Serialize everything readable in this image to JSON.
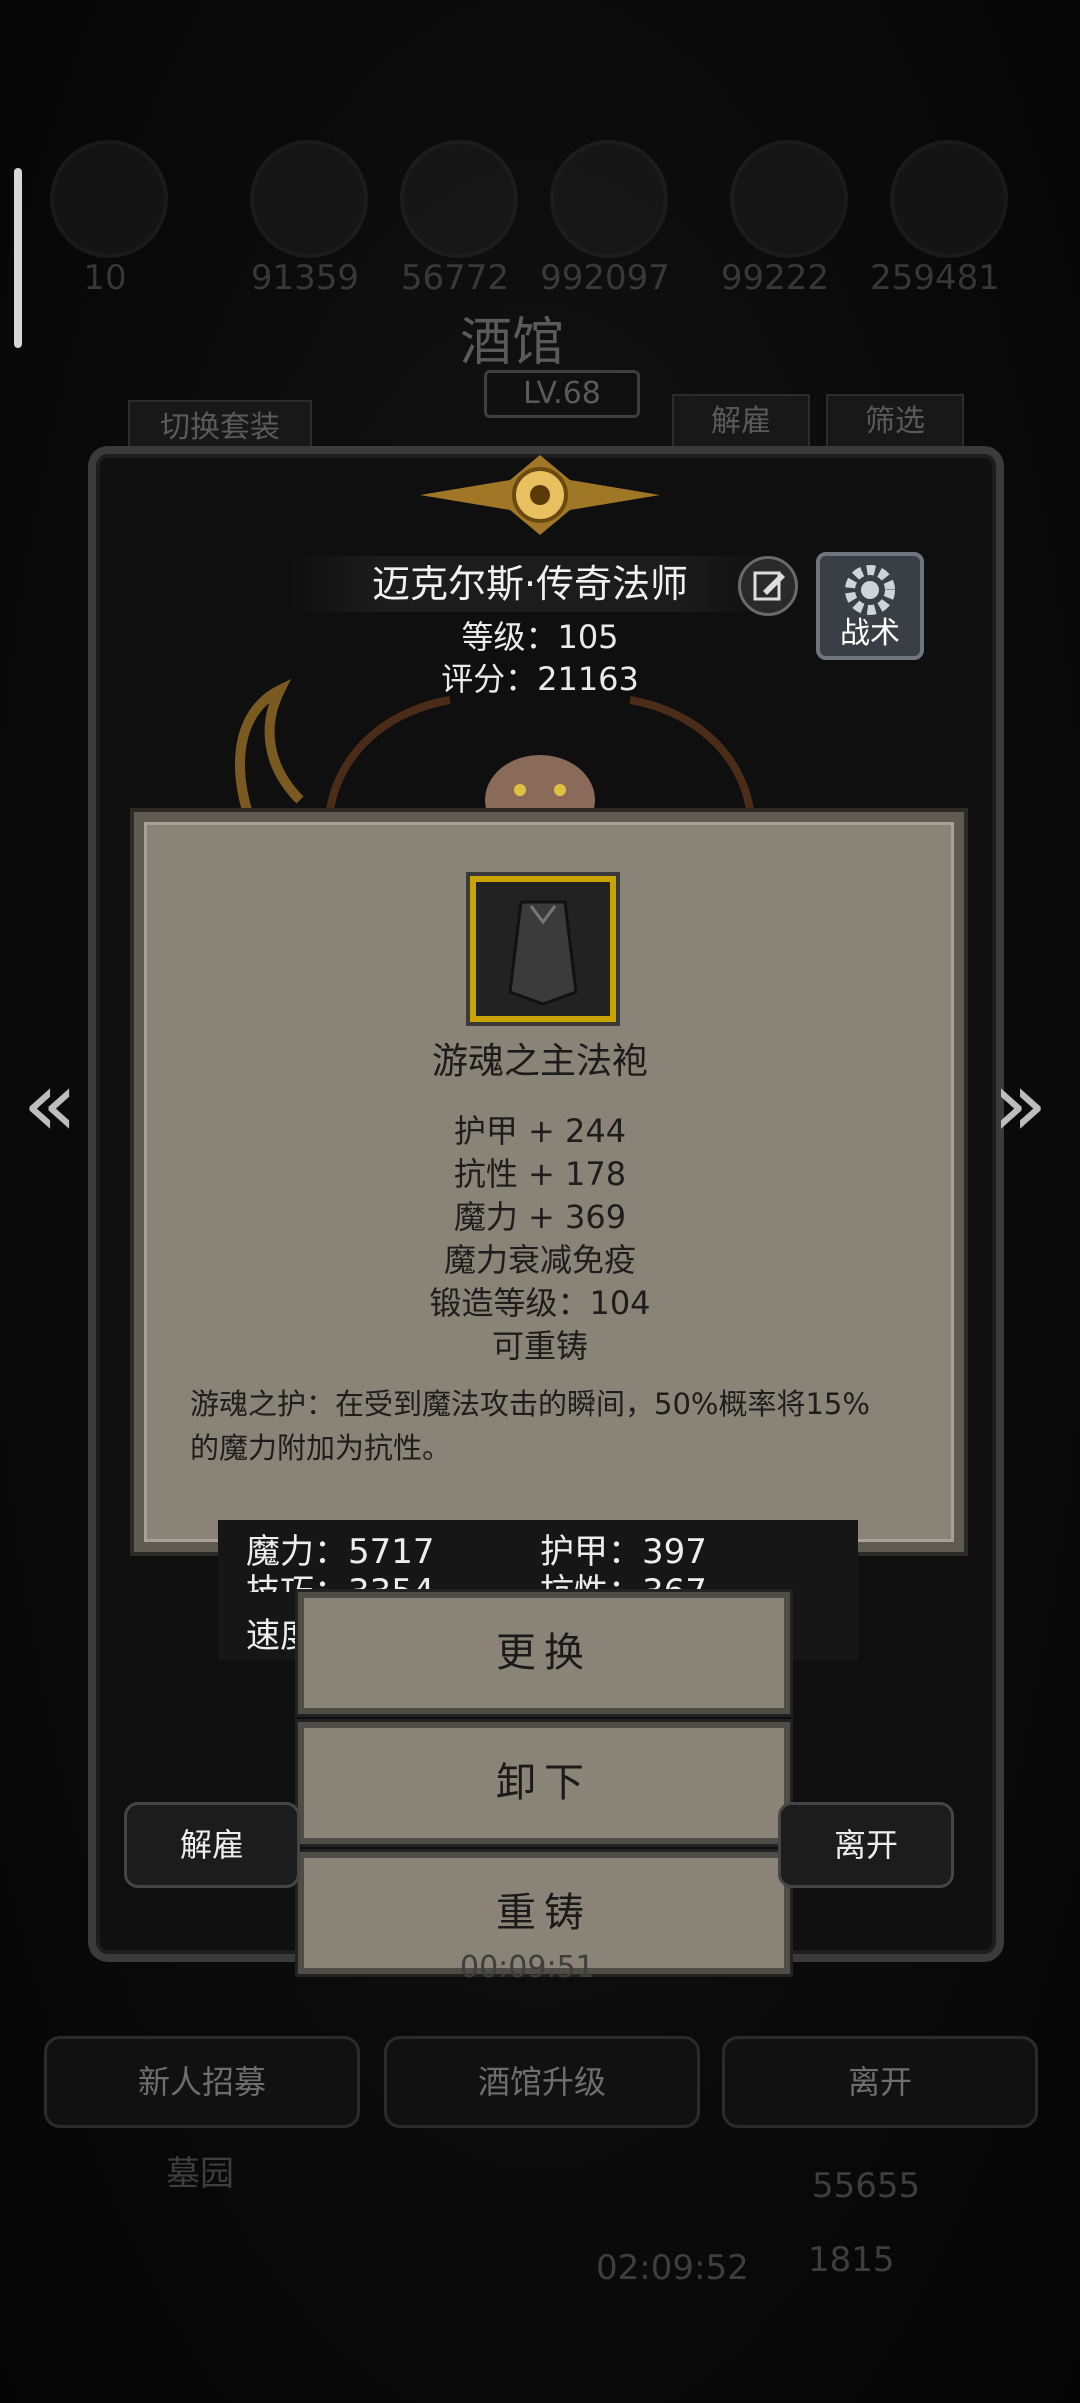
{
  "top_resources": [
    "10",
    "91359",
    "56772",
    "992097",
    "99222",
    "259481"
  ],
  "tavern": {
    "title": "酒馆",
    "level": "LV.68",
    "switch_outfit": "切换套装",
    "dismiss": "解雇",
    "filter": "筛选"
  },
  "hero": {
    "name": "迈克尔斯·传奇法师",
    "level": "等级：105",
    "score": "评分：21163",
    "tactics_label": "战术"
  },
  "item": {
    "icon": "robe-icon",
    "name": "游魂之主法袍",
    "attributes": [
      "护甲 + 244",
      "抗性 + 178",
      "魔力 + 369",
      "魔力衰减免疫",
      "锻造等级：104",
      "可重铸"
    ],
    "description": "游魂之护：在受到魔法攻击的瞬间，50%概率将15%的魔力附加为抗性。"
  },
  "hero_stats": {
    "magic": "魔力：5717",
    "armor": "护甲：397",
    "skill": "技巧：3354",
    "resist": "抗性：367",
    "speed": "速度"
  },
  "actions": {
    "replace": "更换",
    "unequip": "卸下",
    "reforge": "重铸"
  },
  "side_buttons": {
    "dismiss": "解雇",
    "leave": "离开"
  },
  "timer_dim": "00:09:51",
  "bottom_menu": {
    "recruit": "新人招募",
    "upgrade": "酒馆升级",
    "leave": "离开"
  },
  "footer": {
    "area": "墓园",
    "timer": "02:09:52",
    "gold": "55655",
    "gems": "1815"
  }
}
